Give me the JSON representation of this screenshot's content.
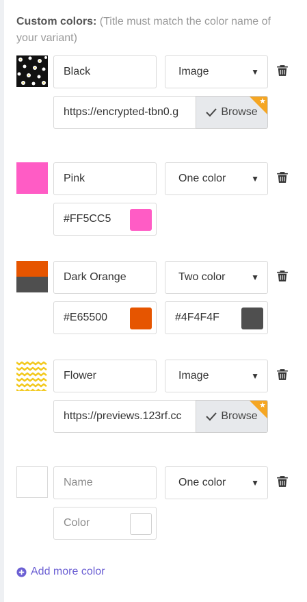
{
  "header": {
    "title": "Custom colors:",
    "hint": "(Title must match the color name of your variant)"
  },
  "colors": [
    {
      "name": "Black",
      "type": "Image",
      "image_url": "https://encrypted-tbn0.g",
      "browse_label": "Browse",
      "swatch": "daisy-pattern-black"
    },
    {
      "name": "Pink",
      "type": "One color",
      "color1_hex": "#FF5CC5"
    },
    {
      "name": "Dark Orange",
      "type": "Two color",
      "color1_hex": "#E65500",
      "color2_hex": "#4F4F4F"
    },
    {
      "name": "Flower",
      "type": "Image",
      "image_url": "https://previews.123rf.cc",
      "browse_label": "Browse",
      "swatch": "yellow-chevron-pattern"
    },
    {
      "name_placeholder": "Name",
      "type": "One color",
      "color_placeholder": "Color"
    }
  ],
  "footer": {
    "add_more_label": "Add more color"
  },
  "accent_colors": {
    "link": "#6b5fd3",
    "ribbon": "#f5a623",
    "border": "#d9d9d9"
  }
}
